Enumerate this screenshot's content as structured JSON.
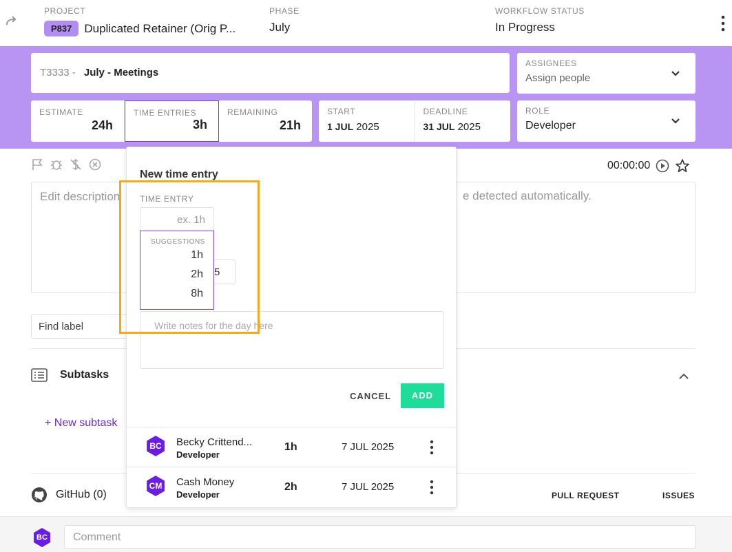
{
  "header": {
    "project_label": "PROJECT",
    "project_badge": "P837",
    "project_name": "Duplicated Retainer (Orig P...",
    "phase_label": "PHASE",
    "phase_value": "July",
    "status_label": "WORKFLOW STATUS",
    "status_value": "In Progress"
  },
  "task": {
    "code": "T3333 -",
    "name": "July - Meetings"
  },
  "assignees": {
    "label": "ASSIGNEES",
    "placeholder": "Assign people"
  },
  "stats": {
    "estimate_label": "ESTIMATE",
    "estimate_value": "24h",
    "time_entries_label": "TIME ENTRIES",
    "time_entries_value": "3h",
    "remaining_label": "REMAINING",
    "remaining_value": "21h"
  },
  "dates": {
    "start_label": "START",
    "start_daymonth": "1 JUL",
    "start_year": "2025",
    "deadline_label": "DEADLINE",
    "deadline_daymonth": "31 JUL",
    "deadline_year": "2025"
  },
  "role": {
    "label": "ROLE",
    "value": "Developer"
  },
  "timer": {
    "value": "00:00:00"
  },
  "description": {
    "placeholder_left": "Edit description",
    "placeholder_right": "e detected automatically."
  },
  "find_label": {
    "placeholder": "Find label"
  },
  "subtasks": {
    "title": "Subtasks",
    "new_link": "+ New subtask"
  },
  "github": {
    "title": "GitHub (0)",
    "pull_request": "PULL REQUEST",
    "issues": "ISSUES"
  },
  "comment": {
    "avatar": "BC",
    "placeholder": "Comment"
  },
  "popup": {
    "title": "New time entry",
    "time_entry_label": "TIME ENTRY",
    "time_entry_placeholder": "ex. 1h",
    "hidden_field_value": "5",
    "suggestions_label": "SUGGESTIONS",
    "suggestions": [
      "1h",
      "2h",
      "8h"
    ],
    "notes_placeholder": "Write notes for the day here",
    "cancel_label": "CANCEL",
    "add_label": "ADD",
    "entries": [
      {
        "initials": "BC",
        "name": "Becky Crittend...",
        "role": "Developer",
        "hours": "1h",
        "date": "7 JUL 2025"
      },
      {
        "initials": "CM",
        "name": "Cash Money",
        "role": "Developer",
        "hours": "2h",
        "date": "7 JUL 2025"
      }
    ]
  },
  "colors": {
    "band": "#b895f2",
    "accent": "#6b1ee0",
    "add_button": "#1fdc9a",
    "highlight": "#f4a81c"
  }
}
